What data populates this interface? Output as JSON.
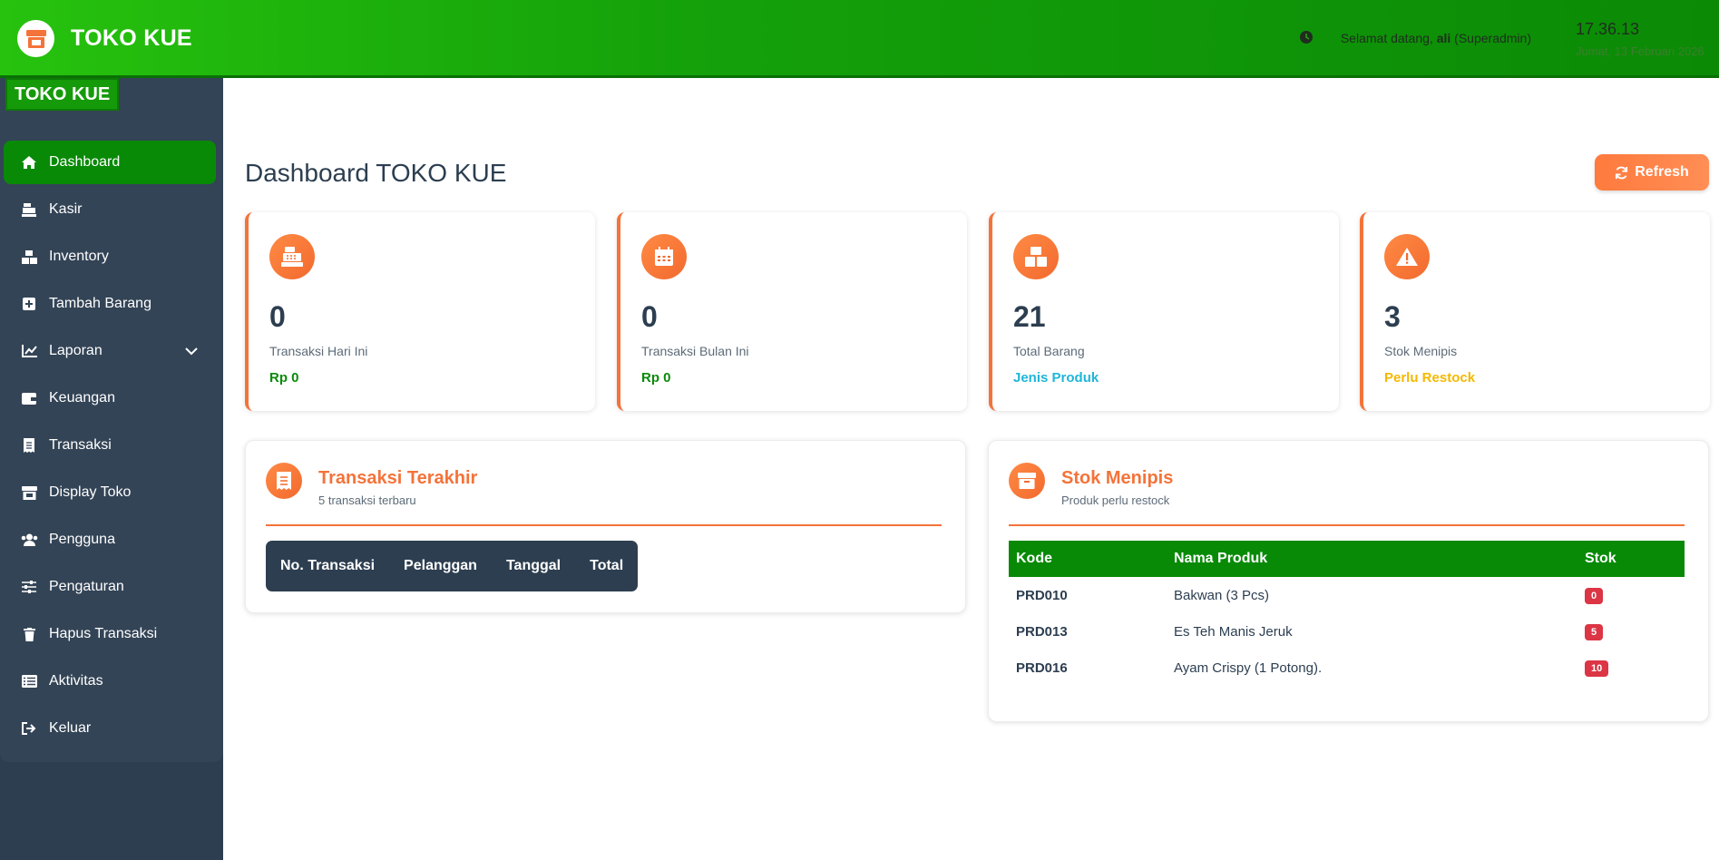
{
  "header": {
    "app_name": "TOKO KUE",
    "welcome_prefix": "Selamat datang,",
    "user_name": "ali",
    "user_role": "(Superadmin)",
    "time": "17.36.13",
    "date": "Jumat, 13 Februari 2026"
  },
  "sidebar": {
    "badge": "TOKO KUE",
    "items": [
      {
        "label": "Dashboard",
        "icon": "home-icon",
        "active": true
      },
      {
        "label": "Kasir",
        "icon": "cash-register-icon"
      },
      {
        "label": "Inventory",
        "icon": "boxes-icon"
      },
      {
        "label": "Tambah Barang",
        "icon": "plus-square-icon"
      },
      {
        "label": "Laporan",
        "icon": "chart-line-icon",
        "has_submenu": true
      },
      {
        "label": "Keuangan",
        "icon": "wallet-icon"
      },
      {
        "label": "Transaksi",
        "icon": "receipt-icon"
      },
      {
        "label": "Display Toko",
        "icon": "store-icon"
      },
      {
        "label": "Pengguna",
        "icon": "users-icon"
      },
      {
        "label": "Pengaturan",
        "icon": "sliders-icon"
      },
      {
        "label": "Hapus Transaksi",
        "icon": "trash-icon"
      },
      {
        "label": "Aktivitas",
        "icon": "list-icon"
      },
      {
        "label": "Keluar",
        "icon": "sign-out-icon"
      }
    ]
  },
  "main": {
    "title": "Dashboard TOKO KUE",
    "refresh_label": "Refresh",
    "stats": [
      {
        "value": "0",
        "label": "Transaksi Hari Ini",
        "sub": "Rp 0",
        "sub_color": "#0a8a0a",
        "icon": "cash-register-icon"
      },
      {
        "value": "0",
        "label": "Transaksi Bulan Ini",
        "sub": "Rp 0",
        "sub_color": "#0a8a0a",
        "icon": "calendar-icon"
      },
      {
        "value": "21",
        "label": "Total Barang",
        "sub": "Jenis Produk",
        "sub_color": "#1fb6d9",
        "icon": "boxes-icon"
      },
      {
        "value": "3",
        "label": "Stok Menipis",
        "sub": "Perlu Restock",
        "sub_color": "#f5b800",
        "icon": "warning-icon"
      }
    ],
    "recent": {
      "title": "Transaksi Terakhir",
      "subtitle": "5 transaksi terbaru",
      "columns": [
        "No. Transaksi",
        "Pelanggan",
        "Tanggal",
        "Total"
      ]
    },
    "low_stock": {
      "title": "Stok Menipis",
      "subtitle": "Produk perlu restock",
      "columns": [
        "Kode",
        "Nama Produk",
        "Stok"
      ],
      "rows": [
        {
          "code": "PRD010",
          "name": "Bakwan (3 Pcs)",
          "stock": "0"
        },
        {
          "code": "PRD013",
          "name": "Es Teh Manis Jeruk",
          "stock": "5"
        },
        {
          "code": "PRD016",
          "name": "Ayam Crispy (1 Potong).",
          "stock": "10"
        }
      ]
    }
  },
  "colors": {
    "brand_green": "#088a07",
    "accent_orange": "#f4733a",
    "sidebar_bg": "#2d3e50",
    "danger": "#dc3545"
  }
}
